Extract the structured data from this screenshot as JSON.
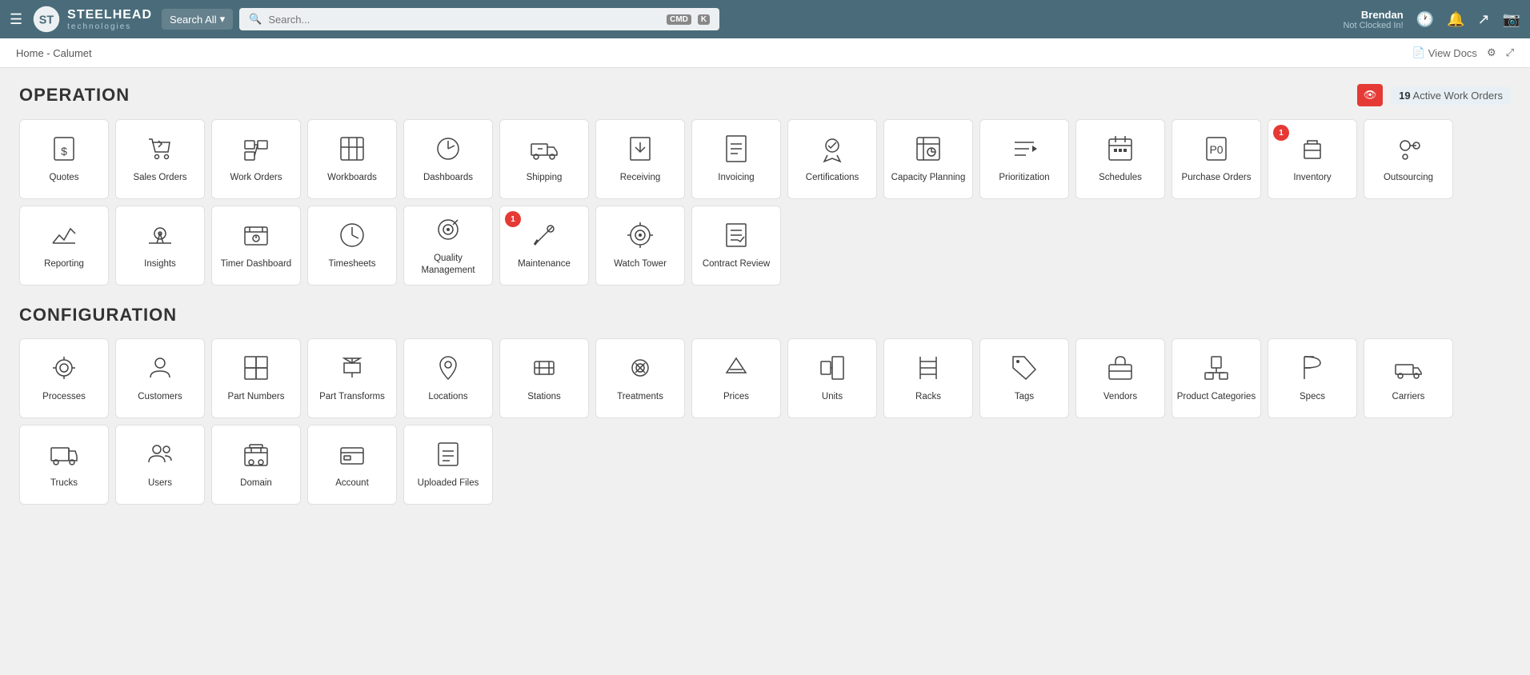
{
  "header": {
    "menu_label": "☰",
    "logo_text": "STEELHEAD",
    "logo_sub": "technologies",
    "search_all_label": "Search All",
    "search_placeholder": "Search...",
    "kbd1": "CMD",
    "kbd2": "K",
    "user_name": "Brendan",
    "user_status": "Not Clocked In!",
    "view_docs_label": "View Docs"
  },
  "breadcrumb": {
    "text": "Home - Calumet"
  },
  "operation": {
    "title": "OPERATION",
    "active_orders_count": "19",
    "active_orders_label": "Active Work Orders",
    "tiles": [
      {
        "id": "quotes",
        "label": "Quotes",
        "badge": null
      },
      {
        "id": "sales-orders",
        "label": "Sales Orders",
        "badge": null
      },
      {
        "id": "work-orders",
        "label": "Work Orders",
        "badge": null
      },
      {
        "id": "workboards",
        "label": "Workboards",
        "badge": null
      },
      {
        "id": "dashboards",
        "label": "Dashboards",
        "badge": null
      },
      {
        "id": "shipping",
        "label": "Shipping",
        "badge": null
      },
      {
        "id": "receiving",
        "label": "Receiving",
        "badge": null
      },
      {
        "id": "invoicing",
        "label": "Invoicing",
        "badge": null
      },
      {
        "id": "certifications",
        "label": "Certifications",
        "badge": null
      },
      {
        "id": "capacity-planning",
        "label": "Capacity Planning",
        "badge": null
      },
      {
        "id": "prioritization",
        "label": "Prioritization",
        "badge": null
      },
      {
        "id": "schedules",
        "label": "Schedules",
        "badge": null
      },
      {
        "id": "purchase-orders",
        "label": "Purchase Orders",
        "badge": null
      },
      {
        "id": "inventory",
        "label": "Inventory",
        "badge": "1"
      },
      {
        "id": "outsourcing",
        "label": "Outsourcing",
        "badge": null
      },
      {
        "id": "reporting",
        "label": "Reporting",
        "badge": null
      },
      {
        "id": "insights",
        "label": "Insights",
        "badge": null
      },
      {
        "id": "timer-dashboard",
        "label": "Timer Dashboard",
        "badge": null
      },
      {
        "id": "timesheets",
        "label": "Timesheets",
        "badge": null
      },
      {
        "id": "quality-management",
        "label": "Quality Management",
        "badge": null
      },
      {
        "id": "maintenance",
        "label": "Maintenance",
        "badge": "1"
      },
      {
        "id": "watch-tower",
        "label": "Watch Tower",
        "badge": null
      },
      {
        "id": "contract-review",
        "label": "Contract Review",
        "badge": null
      }
    ]
  },
  "configuration": {
    "title": "CONFIGURATION",
    "tiles": [
      {
        "id": "processes",
        "label": "Processes"
      },
      {
        "id": "customers",
        "label": "Customers"
      },
      {
        "id": "part-numbers",
        "label": "Part Numbers"
      },
      {
        "id": "part-transforms",
        "label": "Part Transforms"
      },
      {
        "id": "locations",
        "label": "Locations"
      },
      {
        "id": "stations",
        "label": "Stations"
      },
      {
        "id": "treatments",
        "label": "Treatments"
      },
      {
        "id": "prices",
        "label": "Prices"
      },
      {
        "id": "units",
        "label": "Units"
      },
      {
        "id": "racks",
        "label": "Racks"
      },
      {
        "id": "tags",
        "label": "Tags"
      },
      {
        "id": "vendors",
        "label": "Vendors"
      },
      {
        "id": "product-categories",
        "label": "Product Categories"
      },
      {
        "id": "specs",
        "label": "Specs"
      },
      {
        "id": "carriers",
        "label": "Carriers"
      },
      {
        "id": "trucks",
        "label": "Trucks"
      },
      {
        "id": "users",
        "label": "Users"
      },
      {
        "id": "domain",
        "label": "Domain"
      },
      {
        "id": "account",
        "label": "Account"
      },
      {
        "id": "uploaded-files",
        "label": "Uploaded Files"
      }
    ]
  }
}
